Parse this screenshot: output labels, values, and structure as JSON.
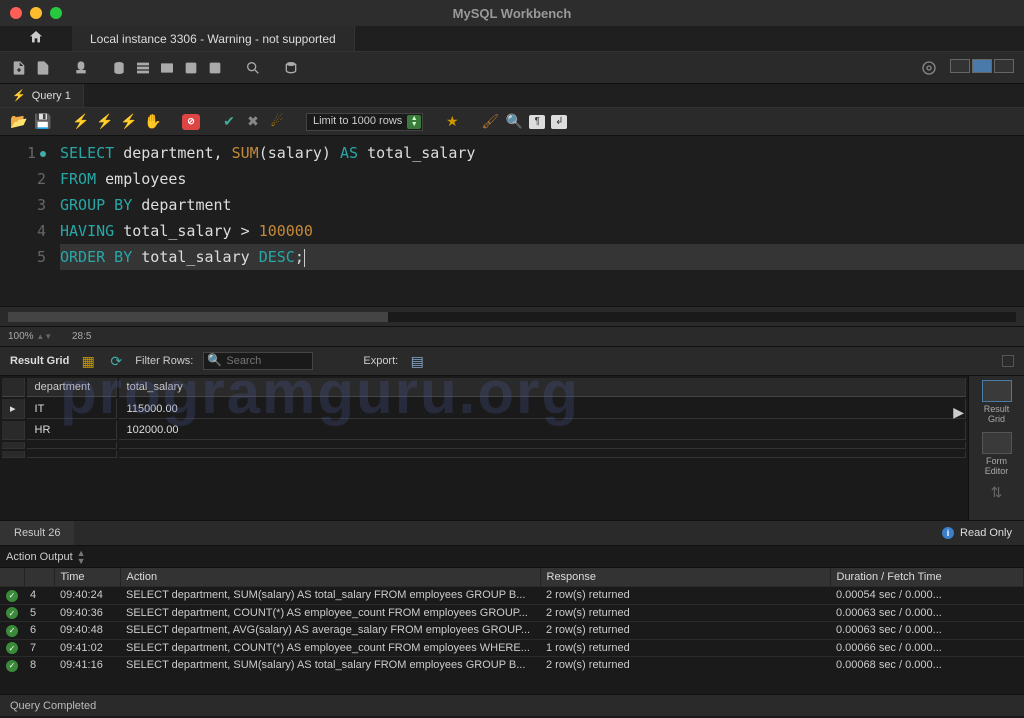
{
  "title": "MySQL Workbench",
  "connection_tab": "Local instance 3306 - Warning - not supported",
  "query_tab": "Query 1",
  "limit_label": "Limit to 1000 rows",
  "editor": {
    "lines": [
      "1",
      "2",
      "3",
      "4",
      "5"
    ]
  },
  "zoom": "100%",
  "cursor_pos": "28:5",
  "result_toolbar": {
    "label": "Result Grid",
    "filter_label": "Filter Rows:",
    "filter_placeholder": "Search",
    "export_label": "Export:"
  },
  "columns": [
    "department",
    "total_salary"
  ],
  "rows": [
    {
      "department": "IT",
      "total_salary": "115000.00"
    },
    {
      "department": "HR",
      "total_salary": "102000.00"
    }
  ],
  "side": {
    "grid": "Result\nGrid",
    "form": "Form\nEditor"
  },
  "result_tab_label": "Result 26",
  "read_only": "Read Only",
  "action_output_label": "Action Output",
  "action_cols": {
    "time": "Time",
    "action": "Action",
    "response": "Response",
    "duration": "Duration / Fetch Time"
  },
  "actions": [
    {
      "idx": "4",
      "time": "09:40:24",
      "action": "SELECT department, SUM(salary) AS total_salary FROM employees GROUP B...",
      "response": "2 row(s) returned",
      "duration": "0.00054 sec / 0.000..."
    },
    {
      "idx": "5",
      "time": "09:40:36",
      "action": "SELECT department, COUNT(*) AS employee_count FROM employees GROUP...",
      "response": "2 row(s) returned",
      "duration": "0.00063 sec / 0.000..."
    },
    {
      "idx": "6",
      "time": "09:40:48",
      "action": "SELECT department, AVG(salary) AS average_salary FROM employees GROUP...",
      "response": "2 row(s) returned",
      "duration": "0.00063 sec / 0.000..."
    },
    {
      "idx": "7",
      "time": "09:41:02",
      "action": "SELECT department, COUNT(*) AS employee_count FROM employees WHERE...",
      "response": "1 row(s) returned",
      "duration": "0.00066 sec / 0.000..."
    },
    {
      "idx": "8",
      "time": "09:41:16",
      "action": "SELECT department, SUM(salary) AS total_salary FROM employees GROUP B...",
      "response": "2 row(s) returned",
      "duration": "0.00068 sec / 0.000..."
    }
  ],
  "status": "Query Completed",
  "watermark": "programguru.org"
}
